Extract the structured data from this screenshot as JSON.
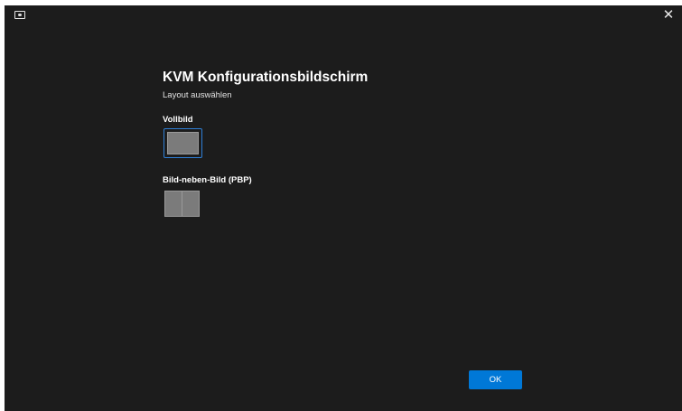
{
  "window": {
    "close_glyph": "✕"
  },
  "dialog": {
    "title": "KVM Konfigurationsbildschirm",
    "subtitle": "Layout auswählen",
    "layouts": [
      {
        "label": "Vollbild",
        "selected": true
      },
      {
        "label": "Bild-neben-Bild (PBP)",
        "selected": false
      }
    ],
    "ok_label": "OK"
  },
  "colors": {
    "background": "#1c1c1c",
    "accent": "#0078d7",
    "selection_border": "#2f7fd6"
  },
  "icons": [
    "monitor-icon",
    "close-icon",
    "fullscreen-layout-icon",
    "pbp-layout-icon"
  ]
}
